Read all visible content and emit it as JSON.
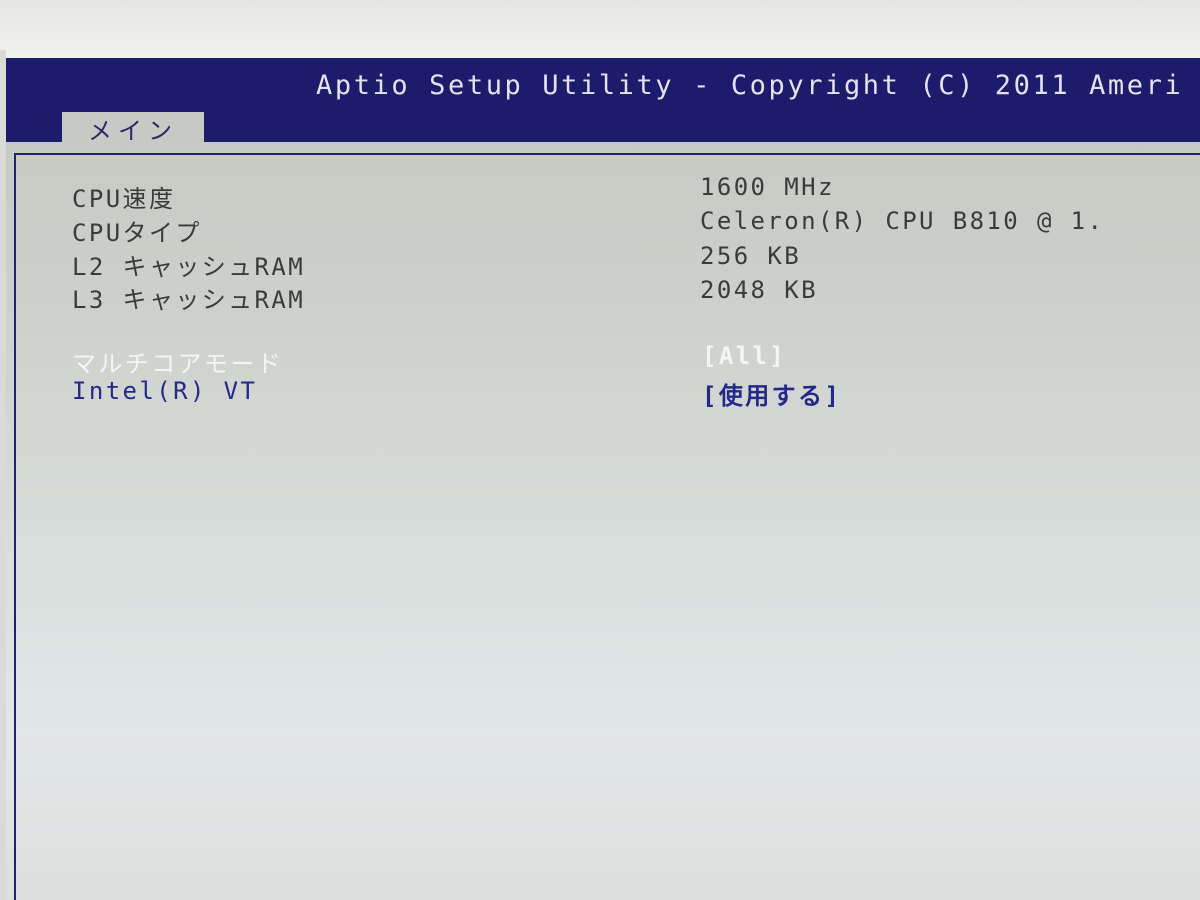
{
  "window": {
    "title": "Aptio Setup Utility - Copyright (C) 2011 Ameri"
  },
  "tabs": [
    {
      "label": "メイン",
      "selected": true
    }
  ],
  "items": [
    {
      "label": "CPU速度",
      "value": "1600 MHz"
    },
    {
      "label": "CPUタイプ",
      "value": "Celeron(R) CPU B810 @ 1."
    },
    {
      "label": "L2 キャッシュRAM",
      "value": "256 KB"
    },
    {
      "label": "L3 キャッシュRAM",
      "value": "2048 KB"
    },
    {
      "label": "マルチコアモード",
      "value": "[All]"
    },
    {
      "label": "Intel(R) VT",
      "value": "[使用する]"
    }
  ],
  "colors": {
    "title_bar": "#1c1b6c",
    "selected_item": "#25288a",
    "highlight_text": "#f4f6f4"
  }
}
